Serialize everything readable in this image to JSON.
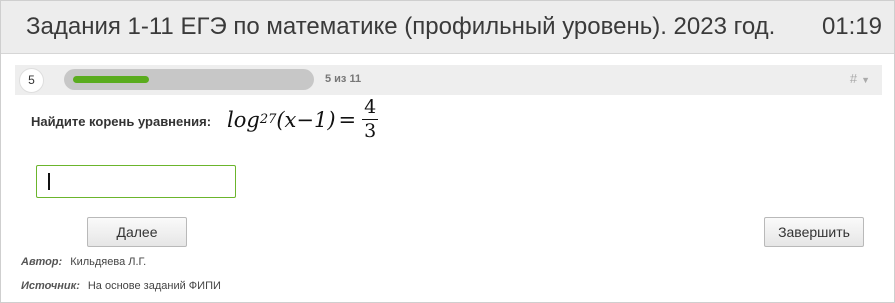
{
  "header": {
    "title": "Задания 1-11 ЕГЭ по математике (профильный уровень). 2023 год.",
    "timer": "01:19"
  },
  "progress": {
    "question_number": "5",
    "count_text": "5 из 11",
    "fraction": 0.4545,
    "menu_label": "#"
  },
  "question": {
    "prompt": "Найдите корень уравнения:",
    "formula": {
      "func": "log",
      "base": "27",
      "argument": "(x−1)",
      "equals": "=",
      "numerator": "4",
      "denominator": "3"
    }
  },
  "answer": {
    "value": ""
  },
  "buttons": {
    "next": "Далее",
    "finish": "Завершить"
  },
  "meta": {
    "author_label": "Автор:",
    "author": "Кильдяева Л.Г.",
    "source_label": "Источник:",
    "source": "На основе заданий ФИПИ"
  },
  "colors": {
    "accent": "#5aac1e",
    "input_border": "#6bb52c",
    "header_bg": "#ededed"
  },
  "icons": {
    "menu": "dropdown-caret-icon"
  }
}
